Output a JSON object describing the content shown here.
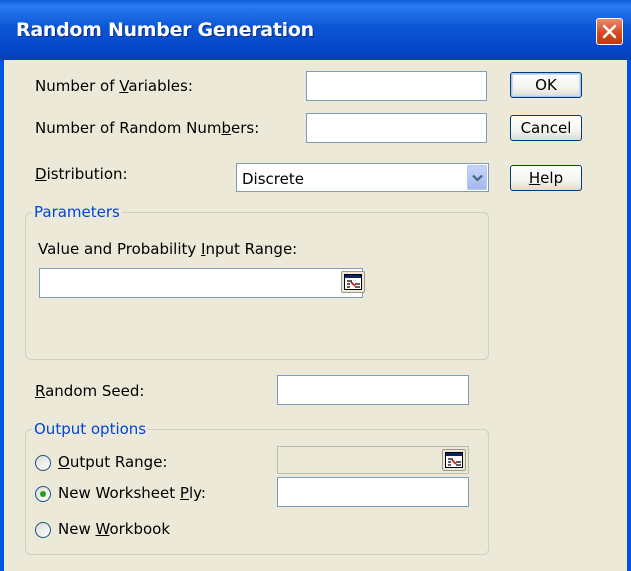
{
  "window": {
    "title": "Random Number Generation"
  },
  "fields": {
    "num_variables": {
      "label_pre": "Number of ",
      "label_key": "V",
      "label_post": "ariables:",
      "value": ""
    },
    "num_random": {
      "label_pre": "Number of Random Num",
      "label_key": "b",
      "label_post": "ers:",
      "value": ""
    },
    "distribution": {
      "label_key": "D",
      "label_post": "istribution:",
      "value": "Discrete"
    }
  },
  "buttons": {
    "ok": "OK",
    "cancel": "Cancel",
    "help_key": "H",
    "help_post": "elp"
  },
  "parameters": {
    "title": "Parameters",
    "input_label_pre": "Value and Probability ",
    "input_label_key": "I",
    "input_label_post": "nput Range:",
    "input_value": ""
  },
  "seed": {
    "label_key": "R",
    "label_post": "andom Seed:",
    "value": ""
  },
  "output": {
    "title": "Output options",
    "output_range": {
      "label_key": "O",
      "label_post": "utput Range:",
      "selected": false
    },
    "new_ply": {
      "label_pre": "New Worksheet ",
      "label_key": "P",
      "label_post": "ly:",
      "selected": true
    },
    "new_workbook": {
      "label_pre": "New ",
      "label_key": "W",
      "label_post": "orkbook",
      "selected": false
    }
  },
  "icons": {
    "close": "close-icon",
    "dropdown": "chevron-down-icon",
    "range": "collapse-dialog-icon"
  },
  "colors": {
    "title_bar": "#0054e3",
    "group_title": "#0046d5",
    "close_button": "#d5461d",
    "radio_dot": "#21a121"
  }
}
